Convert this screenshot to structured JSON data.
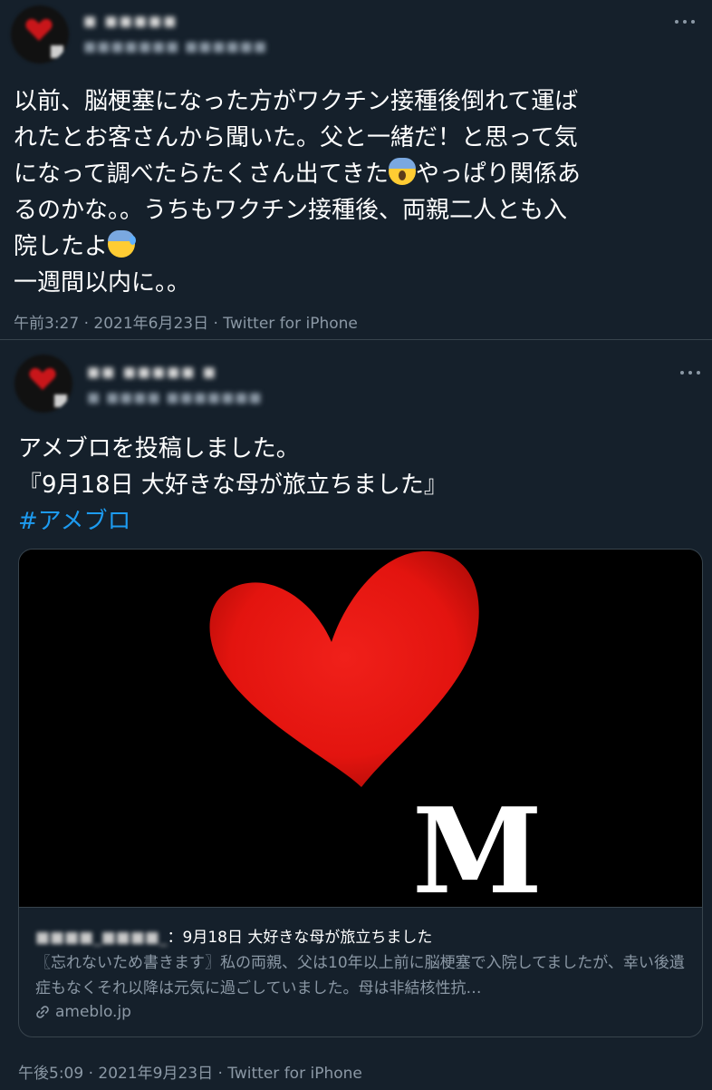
{
  "tweet1": {
    "author_name": "■ ■■■■■",
    "author_handle": "■■■■■■■ ■■■■■■",
    "text_lines": [
      "以前、脳梗塞になった方がワクチン接種後倒れて運ば",
      "れたとお客さんから聞いた。父と一緒だ！と思って気",
      "になって調べたらたくさん出てきた",
      "やっぱり関係あ",
      "るのかな。。うちもワクチン接種後、両親二人とも入",
      "院したよ",
      "一週間以内に。。"
    ],
    "emoji_1": "scream-emoji",
    "emoji_2": "anxious-sweat-emoji",
    "meta": "午前3:27 · 2021年6月23日 · Twitter for iPhone"
  },
  "tweet2": {
    "author_name": "■■ ■■■■■ ■",
    "author_handle": "■ ■■■■ ■■■■■■■",
    "line_1": "アメブロを投稿しました。",
    "line_2": "『9月18日 大好きな母が旅立ちました』",
    "hashtag": "#アメブロ",
    "card": {
      "image_letter": "M",
      "title_author": "■■■■_■■■■_",
      "title_text": "：9月18日 大好きな母が旅立ちました",
      "description": "〖忘れないため書きます〗私の両親、父は10年以上前に脳梗塞で入院してましたが、幸い後遺症もなくそれ以降は元気に過ごしていました。母は非結核性抗…",
      "domain": "ameblo.jp"
    },
    "meta": "午後5:09 · 2021年9月23日 · Twitter for iPhone"
  },
  "colors": {
    "background": "#15202b",
    "divider": "#38444d",
    "secondary_text": "#8b98a5",
    "link": "#1d9bf0",
    "heart": "#e8130f"
  }
}
